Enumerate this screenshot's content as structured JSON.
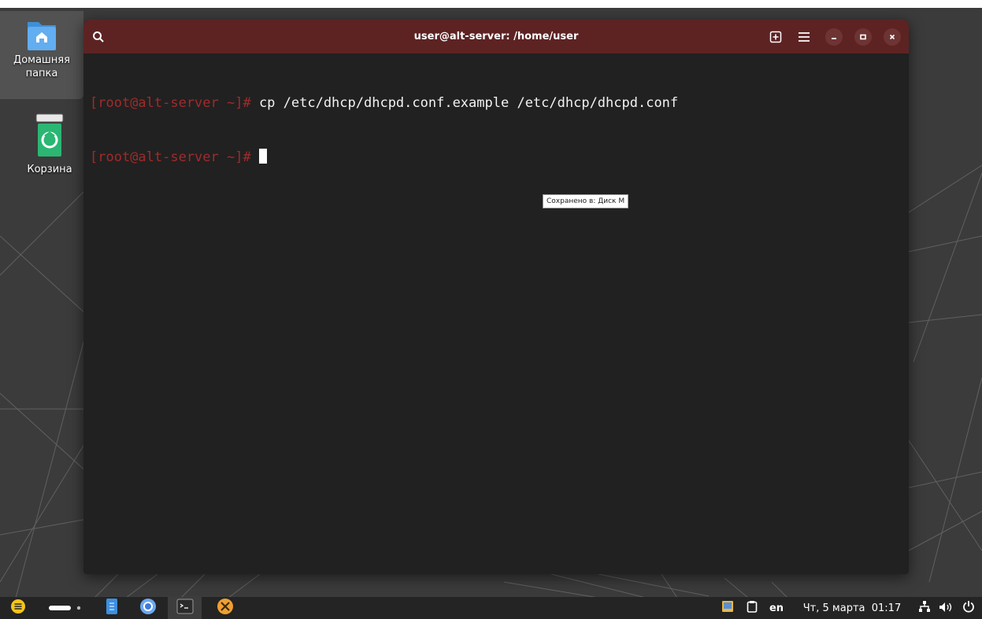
{
  "desktop": {
    "icons": [
      {
        "label_line1": "Домашняя",
        "label_line2": "папка",
        "icon": "home-folder-icon"
      },
      {
        "label_line1": "Корзина",
        "icon": "trash-icon"
      }
    ]
  },
  "window": {
    "title": "user@alt-server: /home/user",
    "buttons": [
      "search-icon",
      "new-tab-icon",
      "menu-icon",
      "minimize-icon",
      "maximize-icon",
      "close-icon"
    ],
    "terminal": {
      "lines": [
        {
          "prompt": "[root@alt-server ~]# ",
          "command": "cp /etc/dhcp/dhcpd.conf.example /etc/dhcp/dhcpd.conf"
        },
        {
          "prompt": "[root@alt-server ~]# ",
          "command": ""
        }
      ]
    },
    "tooltip": "Сохранено в: Диск M"
  },
  "taskbar": {
    "apps": [
      "menu-icon",
      "workspace-indicator",
      "files-icon",
      "chromium-icon",
      "terminal-icon",
      "settings-tools-icon"
    ],
    "tray": {
      "keyboard_layout": "en",
      "datetime": "Чт, 5 марта  01:17",
      "icons": [
        "notes-icon",
        "clipboard-icon",
        "network-icon",
        "volume-icon",
        "power-icon"
      ]
    }
  },
  "colors": {
    "titlebar": "#5d2323",
    "terminal_bg": "#212121",
    "prompt": "#a22a2a",
    "taskbar": "#242424",
    "wallpaper": "#3a3a3a"
  }
}
